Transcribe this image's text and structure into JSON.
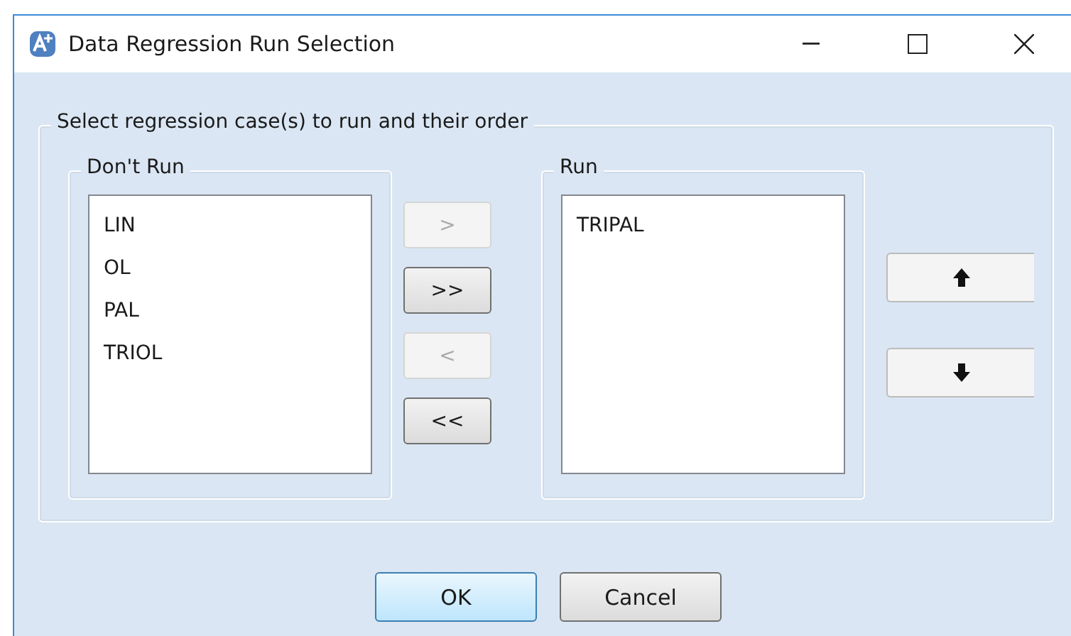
{
  "window": {
    "title": "Data Regression Run Selection"
  },
  "group": {
    "label": "Select regression case(s) to run and their order"
  },
  "dont_run": {
    "label": "Don't Run",
    "items": [
      {
        "label": "LIN",
        "selected": false
      },
      {
        "label": "OL",
        "selected": false
      },
      {
        "label": "PAL",
        "selected": false
      },
      {
        "label": "TRIOL",
        "selected": false
      }
    ]
  },
  "transfer_buttons": [
    {
      "label": ">",
      "disabled": true
    },
    {
      "label": ">>",
      "disabled": false
    },
    {
      "label": "<",
      "disabled": true
    },
    {
      "label": "<<",
      "disabled": false
    }
  ],
  "run": {
    "label": "Run",
    "items": [
      {
        "label": "TRIPAL",
        "selected": false
      }
    ]
  },
  "order_buttons": [
    {
      "kind": "up",
      "disabled": false
    },
    {
      "kind": "down",
      "disabled": false
    }
  ],
  "buttons": [
    {
      "label": "OK",
      "kind": "default"
    },
    {
      "label": "Cancel",
      "kind": "normal"
    }
  ]
}
